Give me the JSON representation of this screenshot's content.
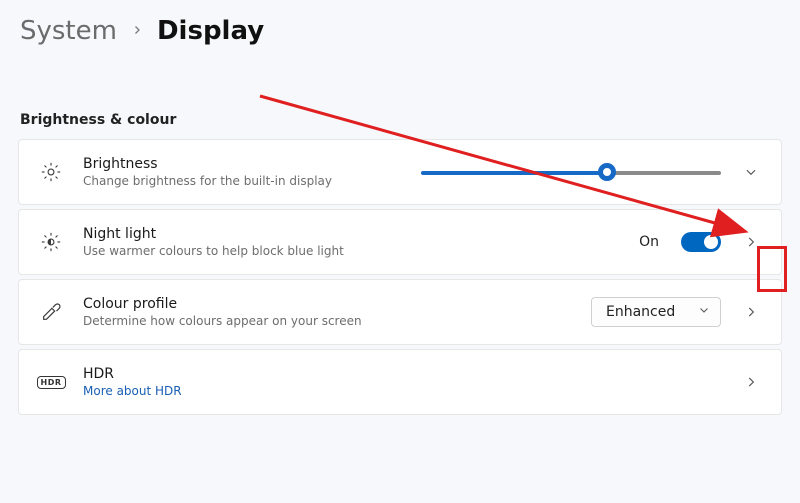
{
  "breadcrumb": {
    "parent": "System",
    "current": "Display"
  },
  "section_title": "Brightness & colour",
  "rows": {
    "brightness": {
      "title": "Brightness",
      "sub": "Change brightness for the built-in display",
      "slider_percent": 62
    },
    "night_light": {
      "title": "Night light",
      "sub": "Use warmer colours to help block blue light",
      "state_label": "On",
      "enabled": true
    },
    "colour_profile": {
      "title": "Colour profile",
      "sub": "Determine how colours appear on your screen",
      "selected": "Enhanced"
    },
    "hdr": {
      "title": "HDR",
      "link": "More about HDR"
    }
  }
}
